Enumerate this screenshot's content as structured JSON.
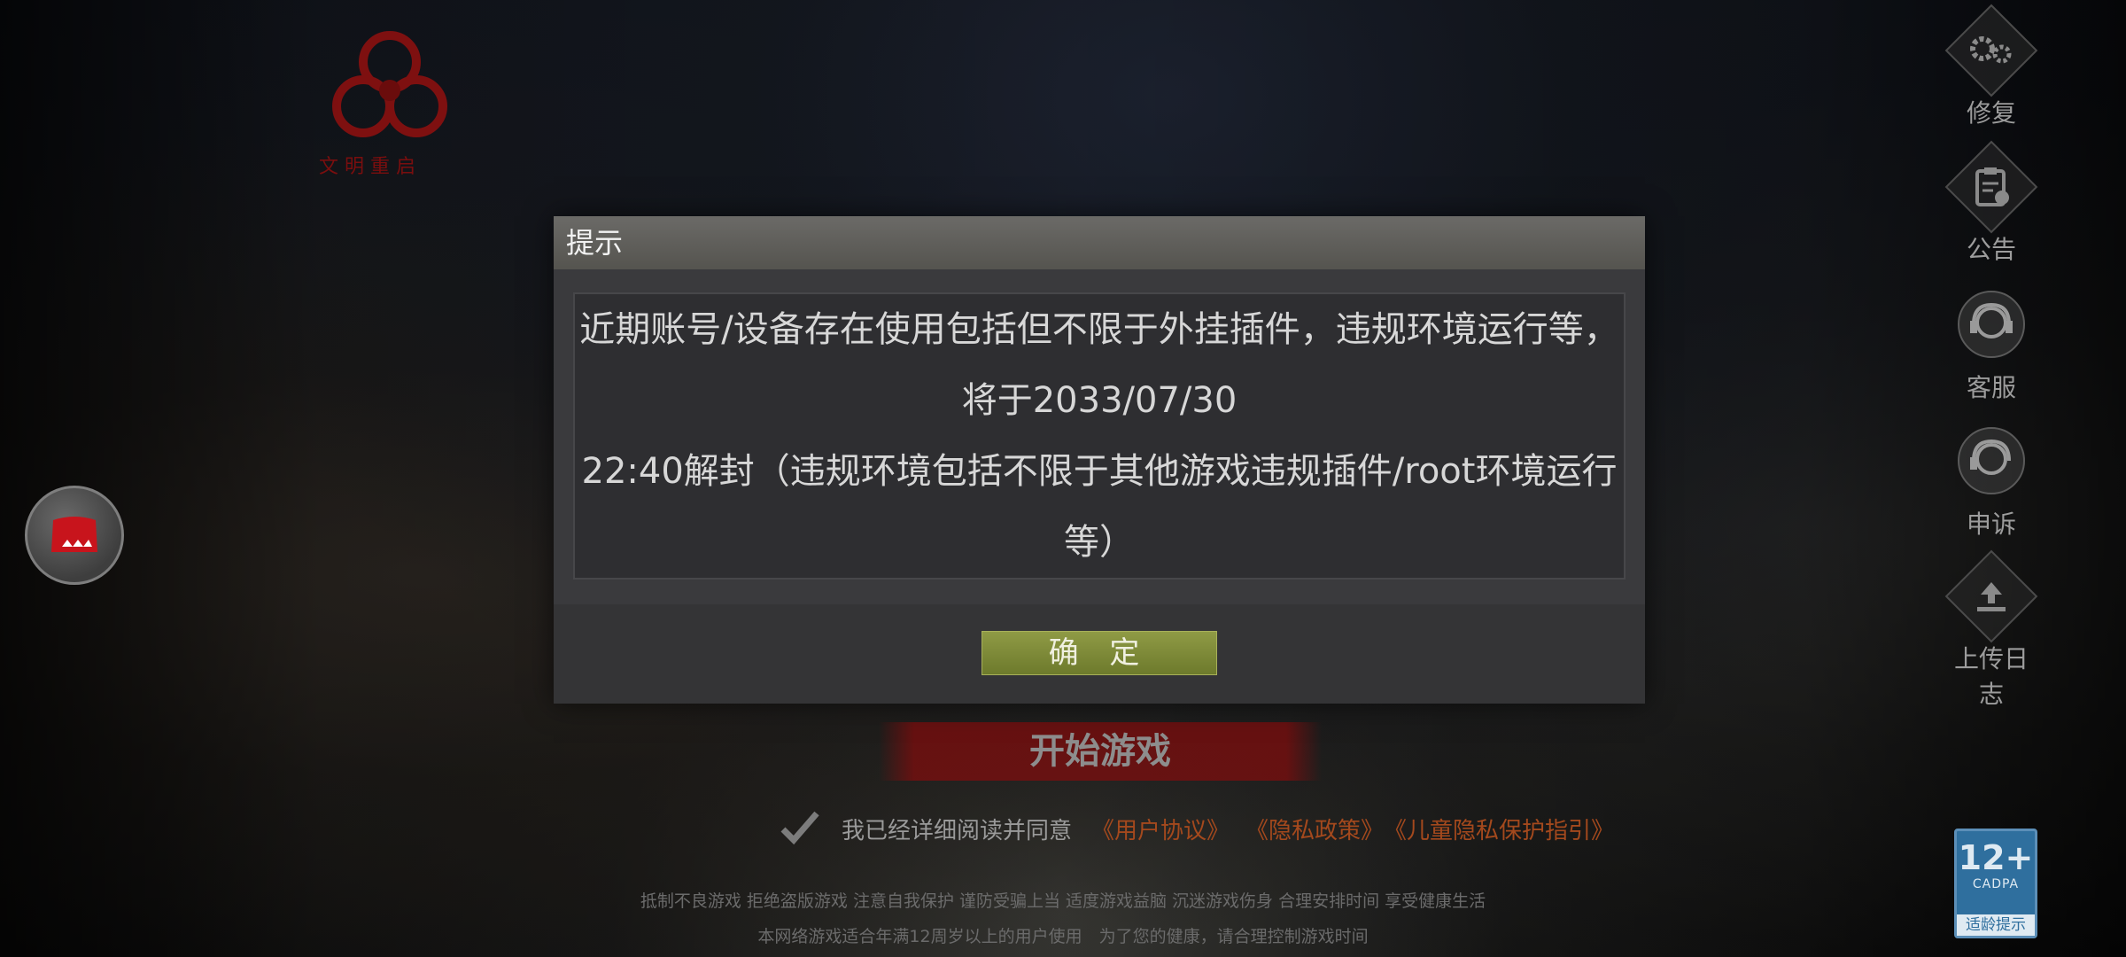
{
  "side_menu": [
    {
      "label": "修复",
      "icon": "gear-icon"
    },
    {
      "label": "公告",
      "icon": "notice-icon"
    },
    {
      "label": "客服",
      "icon": "customer-service-icon"
    },
    {
      "label": "申诉",
      "icon": "appeal-icon"
    },
    {
      "label": "上传日志",
      "icon": "upload-icon"
    }
  ],
  "dialog": {
    "title": "提示",
    "message_line1": "近期账号/设备存在使用包括但不限于外挂插件，违规环境运行等，将于2033/07/30",
    "message_line2": "22:40解封（违规环境包括不限于其他游戏违规插件/root环境运行等）",
    "confirm_label": "确 定"
  },
  "start_button": "开始游戏",
  "agreement": {
    "text": "我已经详细阅读并同意",
    "user_agreement": "《用户协议》",
    "privacy_policy": "《隐私政策》",
    "child_privacy": "《儿童隐私保护指引》"
  },
  "health_notice": {
    "line1": "抵制不良游戏 拒绝盗版游戏 注意自我保护 谨防受骗上当 适度游戏益脑 沉迷游戏伤身 合理安排时间 享受健康生活",
    "line2": "本网络游戏适合年满12周岁以上的用户使用　为了您的健康，请合理控制游戏时间"
  },
  "age_rating": {
    "number": "12+",
    "org": "CADPA",
    "tip": "适龄提示"
  },
  "colors": {
    "accent_link": "#a4491d",
    "confirm_green": "#7d8a38",
    "start_red": "#780e0e",
    "age_blue": "#2f6f9e"
  }
}
